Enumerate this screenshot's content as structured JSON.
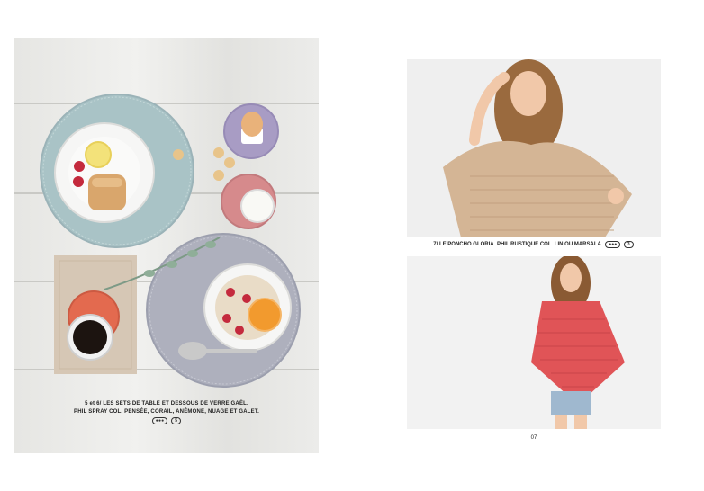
{
  "left_page": {
    "caption_line1": "5 et 6/ LES SETS DE TABLE ET DESSOUS DE VERRE GAËL.",
    "caption_line2": "PHIL SPRAY COL. PENSÉE, CORAIL, ANÉMONE, NUAGE ET GALET.",
    "tag_left": "●●●",
    "tag_right": "5"
  },
  "right_page": {
    "caption": "7/ LE PONCHO GLORIA. PHIL RUSTIQUE COL. LIN OU MARSALA.",
    "tag_left": "●●●",
    "tag_right": "3",
    "page_number": "07"
  },
  "colors": {
    "placemat_blue": "#a9c3c6",
    "placemat_grey": "#aeb0bd",
    "coaster_lilac": "#a89cc4",
    "coaster_pink": "#d68a8c",
    "coaster_coral": "#e36a4f",
    "poncho_beige": "#d4b595",
    "poncho_red": "#e05457"
  }
}
